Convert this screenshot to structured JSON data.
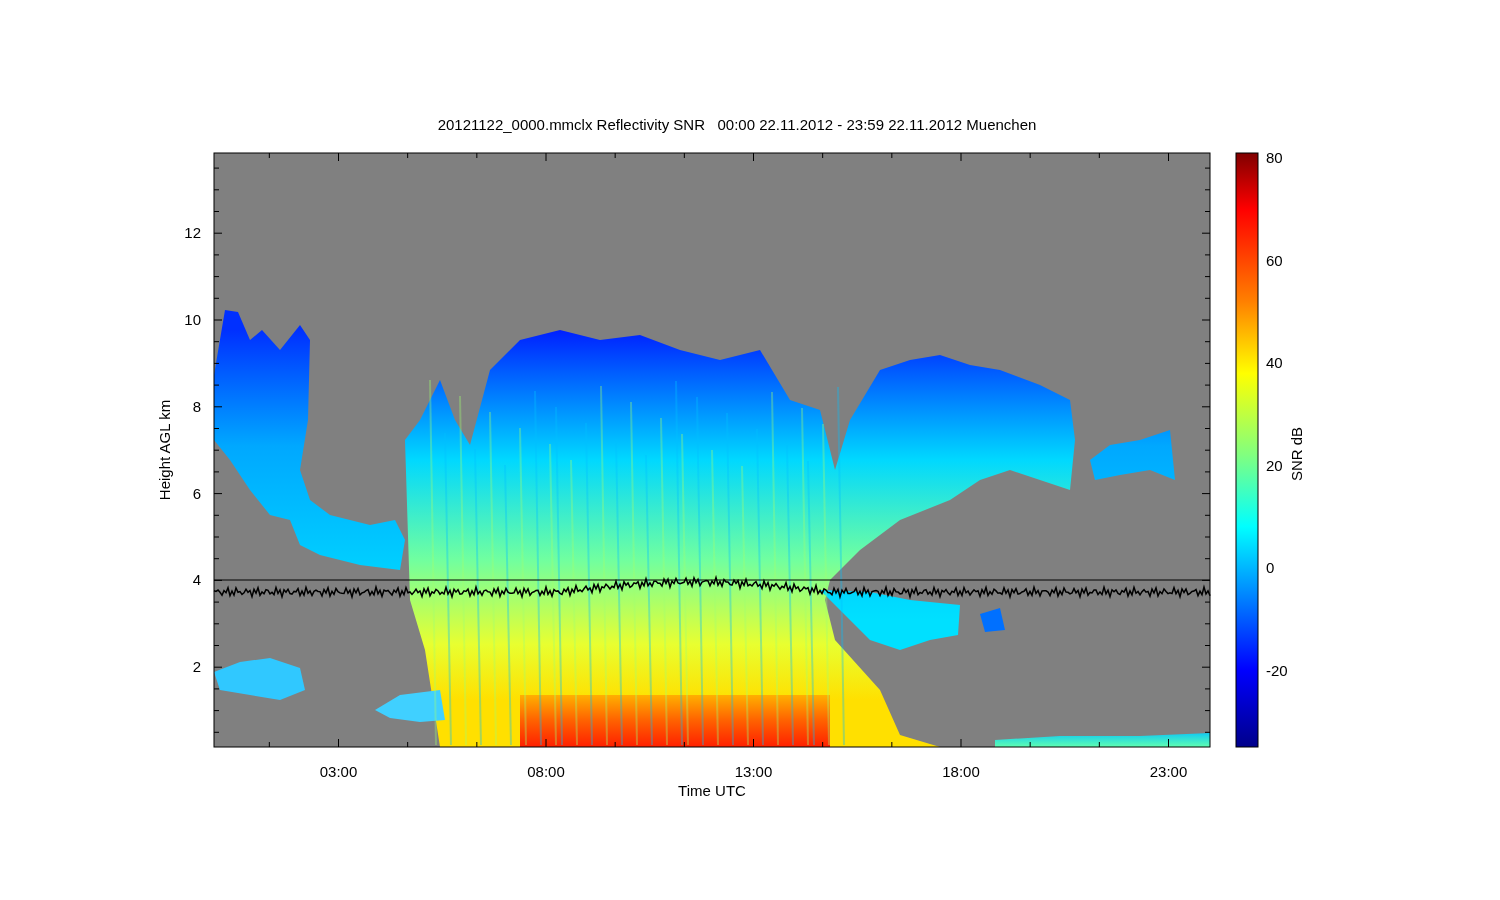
{
  "title": "20121122_0000.mmclx Reflectivity SNR   00:00 22.11.2012 - 23:59 22.11.2012 Muenchen",
  "x_axis": {
    "label": "Time UTC",
    "ticks": [
      "03:00",
      "08:00",
      "13:00",
      "18:00",
      "23:00"
    ]
  },
  "y_axis": {
    "label": "Height AGL km",
    "ticks": [
      "12",
      "10",
      "8",
      "6",
      "4",
      "2"
    ]
  },
  "colorbar": {
    "label": "SNR dB",
    "ticks": [
      "80",
      "60",
      "40",
      "20",
      "0",
      "-20"
    ]
  }
}
